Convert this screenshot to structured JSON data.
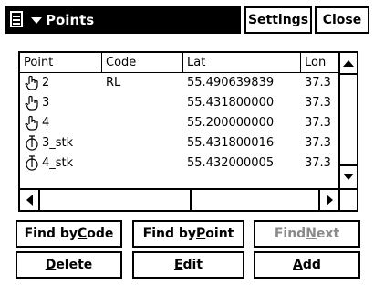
{
  "titlebar": {
    "title": "Points",
    "settings_label": "Settings",
    "close_label": "Close"
  },
  "table": {
    "columns": [
      "Point",
      "Code",
      "Lat",
      "Lon"
    ],
    "rows": [
      {
        "point": "2",
        "code": "RL",
        "lat": "55.490639839",
        "lon": "37.3",
        "icon": "hand-pointer-icon"
      },
      {
        "point": "3",
        "code": "",
        "lat": "55.431800000",
        "lon": "37.3",
        "icon": "hand-pointer-icon"
      },
      {
        "point": "4",
        "code": "",
        "lat": "55.200000000",
        "lon": "37.3",
        "icon": "hand-pointer-icon"
      },
      {
        "point": "3_stk",
        "code": "",
        "lat": "55.431800016",
        "lon": "37.3",
        "icon": "stakeout-icon"
      },
      {
        "point": "4_stk",
        "code": "",
        "lat": "55.432000005",
        "lon": "37.3",
        "icon": "stakeout-icon"
      }
    ]
  },
  "buttons": {
    "find_by_code": {
      "pre": "Find by ",
      "key": "C",
      "post": "ode"
    },
    "find_by_point": {
      "pre": "Find by ",
      "key": "P",
      "post": "oint"
    },
    "find_next": {
      "pre": "Find ",
      "key": "N",
      "post": "ext",
      "disabled": true
    },
    "delete": {
      "pre": "",
      "key": "D",
      "post": "elete"
    },
    "edit": {
      "pre": "",
      "key": "E",
      "post": "dit"
    },
    "add": {
      "pre": "",
      "key": "A",
      "post": "dd"
    }
  }
}
